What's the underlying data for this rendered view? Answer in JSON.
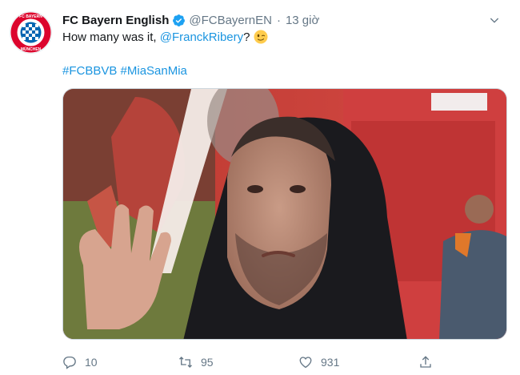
{
  "tweet": {
    "display_name": "FC Bayern English",
    "handle": "@FCBayernEN",
    "separator": "·",
    "time": "13 giờ",
    "text_prefix": "How many was it, ",
    "mention": "@FranckRibery",
    "text_suffix": "?",
    "hashtags": "#FCBBVB #MiaSanMia"
  },
  "avatar": {
    "logo_text": "FC BAYERN MÜNCHEN",
    "colors": {
      "red": "#dc052d",
      "blue": "#0066b2"
    }
  },
  "actions": {
    "reply_count": "10",
    "retweet_count": "95",
    "like_count": "931"
  },
  "icons": {
    "verified": "verified-badge-icon",
    "more": "chevron-down-icon",
    "emoji": "winking-face-emoji",
    "reply": "reply-icon",
    "retweet": "retweet-icon",
    "like": "heart-icon",
    "share": "share-icon"
  },
  "colors": {
    "link": "#1b95e0",
    "secondary": "#657786",
    "verified": "#1da1f2"
  }
}
